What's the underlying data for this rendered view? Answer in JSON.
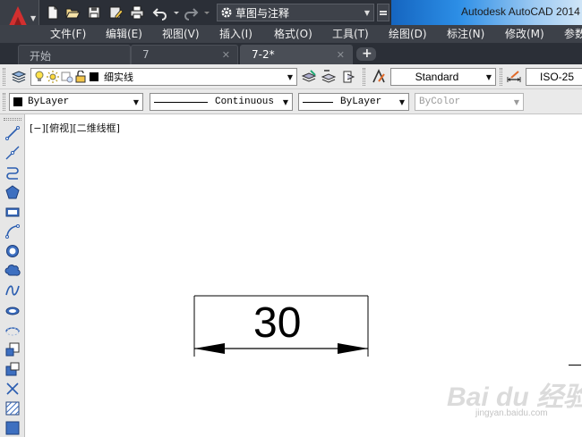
{
  "titlebar": {
    "workspace": "草图与注释",
    "app_title": "Autodesk AutoCAD 2014",
    "colors": {
      "bar": "#2b2f37",
      "accent_red": "#d32f2f"
    }
  },
  "menu": {
    "items": [
      "文件(F)",
      "编辑(E)",
      "视图(V)",
      "插入(I)",
      "格式(O)",
      "工具(T)",
      "绘图(D)",
      "标注(N)",
      "修改(M)",
      "参数"
    ]
  },
  "tabs": [
    {
      "label": "开始",
      "active": false,
      "closable": false
    },
    {
      "label": "7",
      "active": false,
      "closable": true
    },
    {
      "label": "7-2*",
      "active": true,
      "closable": true
    }
  ],
  "tab_close_glyph": "✕",
  "tab_new_glyph": "+",
  "toolbar1": {
    "layer_name": "细实线",
    "text_style": "Standard",
    "dim_style": "ISO-25"
  },
  "toolbar2": {
    "color": "ByLayer",
    "linetype": "Continuous",
    "lineweight": "ByLayer",
    "plotstyle": "ByColor"
  },
  "drawing": {
    "viewport_label": "[−][俯视][二维线框]",
    "dimension_text": "30"
  },
  "watermark": {
    "brand": "Bai du 经验",
    "url": "jingyan.baidu.com"
  }
}
